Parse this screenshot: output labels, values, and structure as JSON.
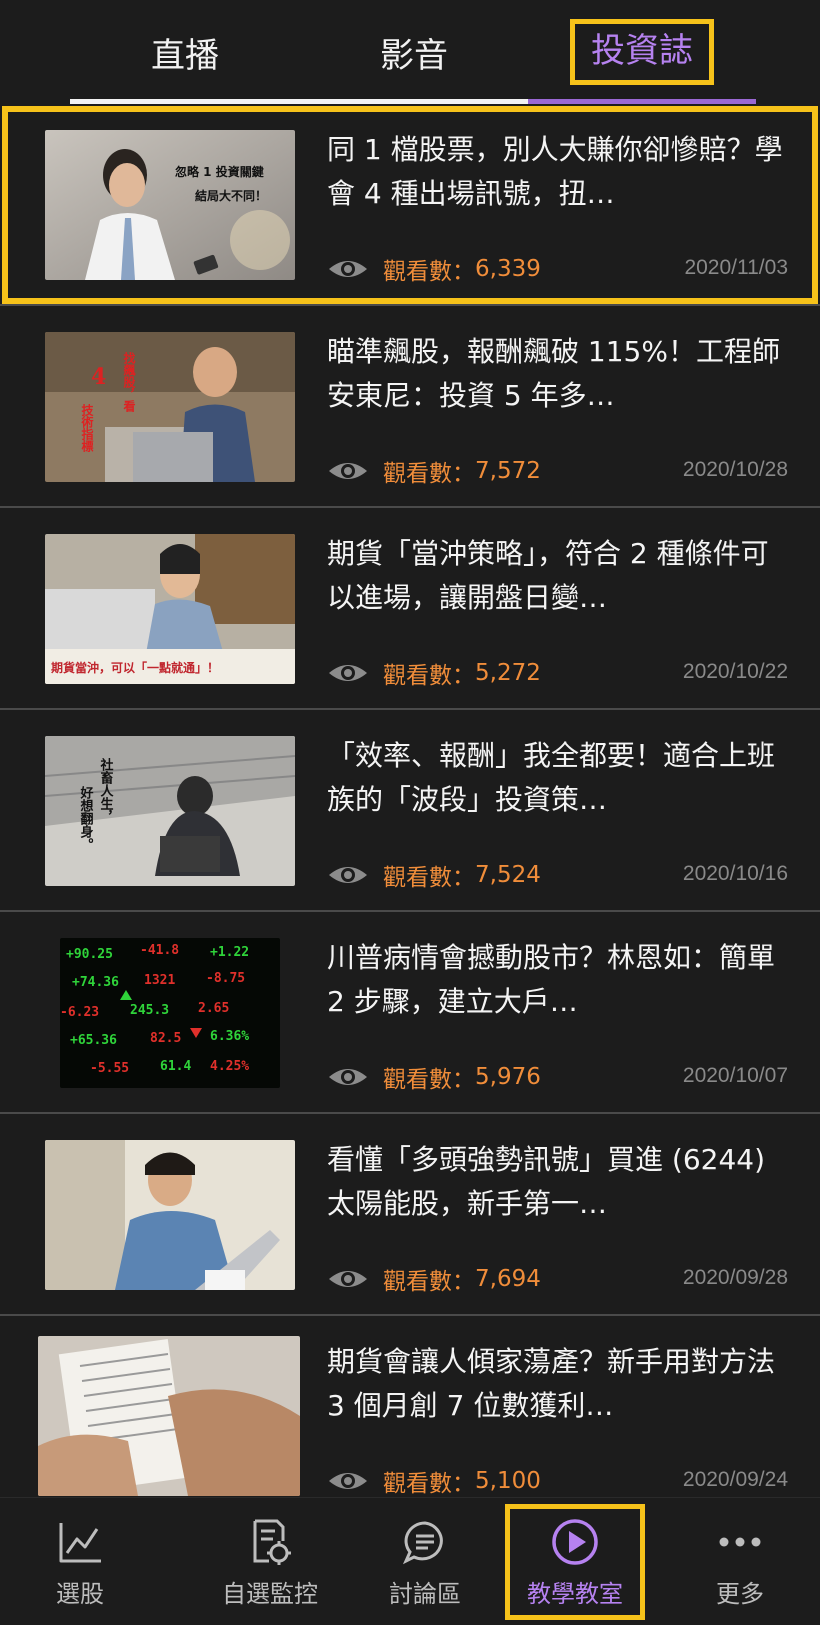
{
  "tabs": [
    {
      "label": "直播"
    },
    {
      "label": "影音"
    },
    {
      "label": "投資誌",
      "active": true
    }
  ],
  "articles": [
    {
      "title": "同 1 檔股票，別人大賺你卻慘賠？學會 4 種出場訊號，扭…",
      "views_label": "觀看數：",
      "views": "6,339",
      "date": "2020/11/03",
      "thumb_caption": [
        "忽略 1 投資關鍵",
        "結局大不同！"
      ]
    },
    {
      "title": "瞄準飆股，報酬飆破 115%！工程師安東尼：投資 5 年多…",
      "views_label": "觀看數：",
      "views": "7,572",
      "date": "2020/10/28",
      "thumb_caption": [
        "4",
        "技術指標",
        "找飆股，看"
      ]
    },
    {
      "title": "期貨「當沖策略」，符合 2 種條件可以進場，讓開盤日變…",
      "views_label": "觀看數：",
      "views": "5,272",
      "date": "2020/10/22",
      "thumb_caption": [
        "期貨當沖，可以「一點就通」！"
      ]
    },
    {
      "title": "「效率、報酬」我全都要！適合上班族的「波段」投資策…",
      "views_label": "觀看數：",
      "views": "7,524",
      "date": "2020/10/16",
      "thumb_caption": [
        "社畜人生，",
        "好想翻身。"
      ]
    },
    {
      "title": "川普病情會撼動股市？林恩如：簡單 2 步驟，建立大戶…",
      "views_label": "觀看數：",
      "views": "5,976",
      "date": "2020/10/07",
      "thumb_caption": []
    },
    {
      "title": "看懂「多頭強勢訊號」買進 (6244) 太陽能股，新手第一…",
      "views_label": "觀看數：",
      "views": "7,694",
      "date": "2020/09/28",
      "thumb_caption": []
    },
    {
      "title": "期貨會讓人傾家蕩產？新手用對方法 3 個月創 7 位數獲利…",
      "views_label": "觀看數：",
      "views": "5,100",
      "date": "2020/09/24",
      "thumb_caption": []
    }
  ],
  "bottom_nav": [
    {
      "label": "選股",
      "icon": "chart-line-icon"
    },
    {
      "label": "自選監控",
      "icon": "document-search-icon"
    },
    {
      "label": "討論區",
      "icon": "chat-bubble-icon"
    },
    {
      "label": "教學教室",
      "icon": "play-circle-icon",
      "active": true
    },
    {
      "label": "更多",
      "icon": "more-dots-icon"
    }
  ],
  "colors": {
    "accent": "#b682f0",
    "views": "#f08d3a",
    "highlight": "#f6c21a",
    "background": "#1c1c1c"
  }
}
